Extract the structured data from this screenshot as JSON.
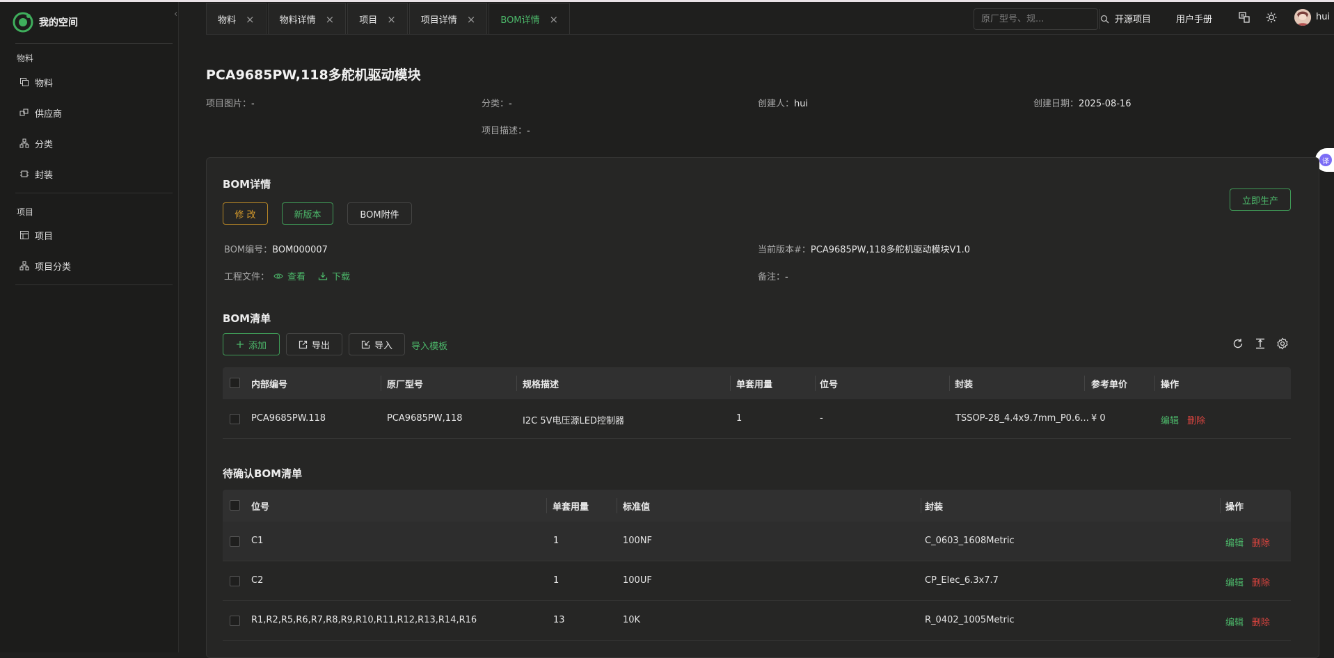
{
  "app": {
    "title": "我的空间"
  },
  "sidebar": {
    "groups": [
      {
        "title": "物料",
        "items": [
          {
            "label": "物料",
            "icon": "copy-icon"
          },
          {
            "label": "供应商",
            "icon": "link-icon"
          },
          {
            "label": "分类",
            "icon": "tree-icon"
          },
          {
            "label": "封装",
            "icon": "chip-icon"
          }
        ]
      },
      {
        "title": "项目",
        "items": [
          {
            "label": "项目",
            "icon": "project-icon"
          },
          {
            "label": "项目分类",
            "icon": "tree-icon"
          }
        ]
      }
    ]
  },
  "tabs": [
    {
      "label": "物料",
      "active": false
    },
    {
      "label": "物料详情",
      "active": false
    },
    {
      "label": "项目",
      "active": false
    },
    {
      "label": "项目详情",
      "active": false
    },
    {
      "label": "BOM详情",
      "active": true
    }
  ],
  "topbar": {
    "search_placeholder": "原厂型号、规...",
    "links": [
      "开源项目",
      "用户手册"
    ],
    "user": "hui",
    "translate_badge": "译"
  },
  "project": {
    "title": "PCA9685PW,118多舵机驱动模块",
    "image_label": "项目图片：",
    "image_value": "-",
    "category_label": "分类：",
    "category_value": "-",
    "creator_label": "创建人：",
    "creator_value": "hui",
    "created_label": "创建日期：",
    "created_value": "2025-08-16",
    "desc_label": "项目描述：",
    "desc_value": "-"
  },
  "bom": {
    "title": "BOM详情",
    "buttons": {
      "edit": "修 改",
      "new_version": "新版本",
      "attachments": "BOM附件",
      "produce": "立即生产"
    },
    "number_label": "BOM编号：",
    "number_value": "BOM000007",
    "version_label": "当前版本#：",
    "version_value": "PCA9685PW,118多舵机驱动模块V1.0",
    "files_label": "工程文件：",
    "view_label": "查看",
    "download_label": "下载",
    "note_label": "备注：",
    "note_value": "-"
  },
  "bom_list": {
    "title": "BOM清单",
    "buttons": {
      "add": "添加",
      "export": "导出",
      "import": "导入",
      "template": "导入模板"
    },
    "columns": [
      "内部编号",
      "原厂型号",
      "规格描述",
      "单套用量",
      "位号",
      "封装",
      "参考单价",
      "操作"
    ],
    "rows": [
      {
        "internal_no": "PCA9685PW.118",
        "mfr_part": "PCA9685PW,118",
        "spec": "I2C 5V电压源LED控制器",
        "qty": "1",
        "ref": "-",
        "package": "TSSOP-28_4.4x9.7mm_P0.6...",
        "price": "¥ 0",
        "edit": "编辑",
        "delete": "删除"
      }
    ]
  },
  "pending_list": {
    "title": "待确认BOM清单",
    "columns": [
      "位号",
      "单套用量",
      "标准值",
      "封装",
      "操作"
    ],
    "rows": [
      {
        "ref": "C1",
        "qty": "1",
        "value": "100NF",
        "package": "C_0603_1608Metric",
        "edit": "编辑",
        "delete": "删除"
      },
      {
        "ref": "C2",
        "qty": "1",
        "value": "100UF",
        "package": "CP_Elec_6.3x7.7",
        "edit": "编辑",
        "delete": "删除"
      },
      {
        "ref": "R1,R2,R5,R6,R7,R8,R9,R10,R11,R12,R13,R14,R16",
        "qty": "13",
        "value": "10K",
        "package": "R_0402_1005Metric",
        "edit": "编辑",
        "delete": "删除"
      }
    ]
  },
  "colors": {
    "accent": "#4cb86a",
    "danger": "#d9443f",
    "warning": "#d49a2c",
    "background": "#1f1f1e"
  }
}
